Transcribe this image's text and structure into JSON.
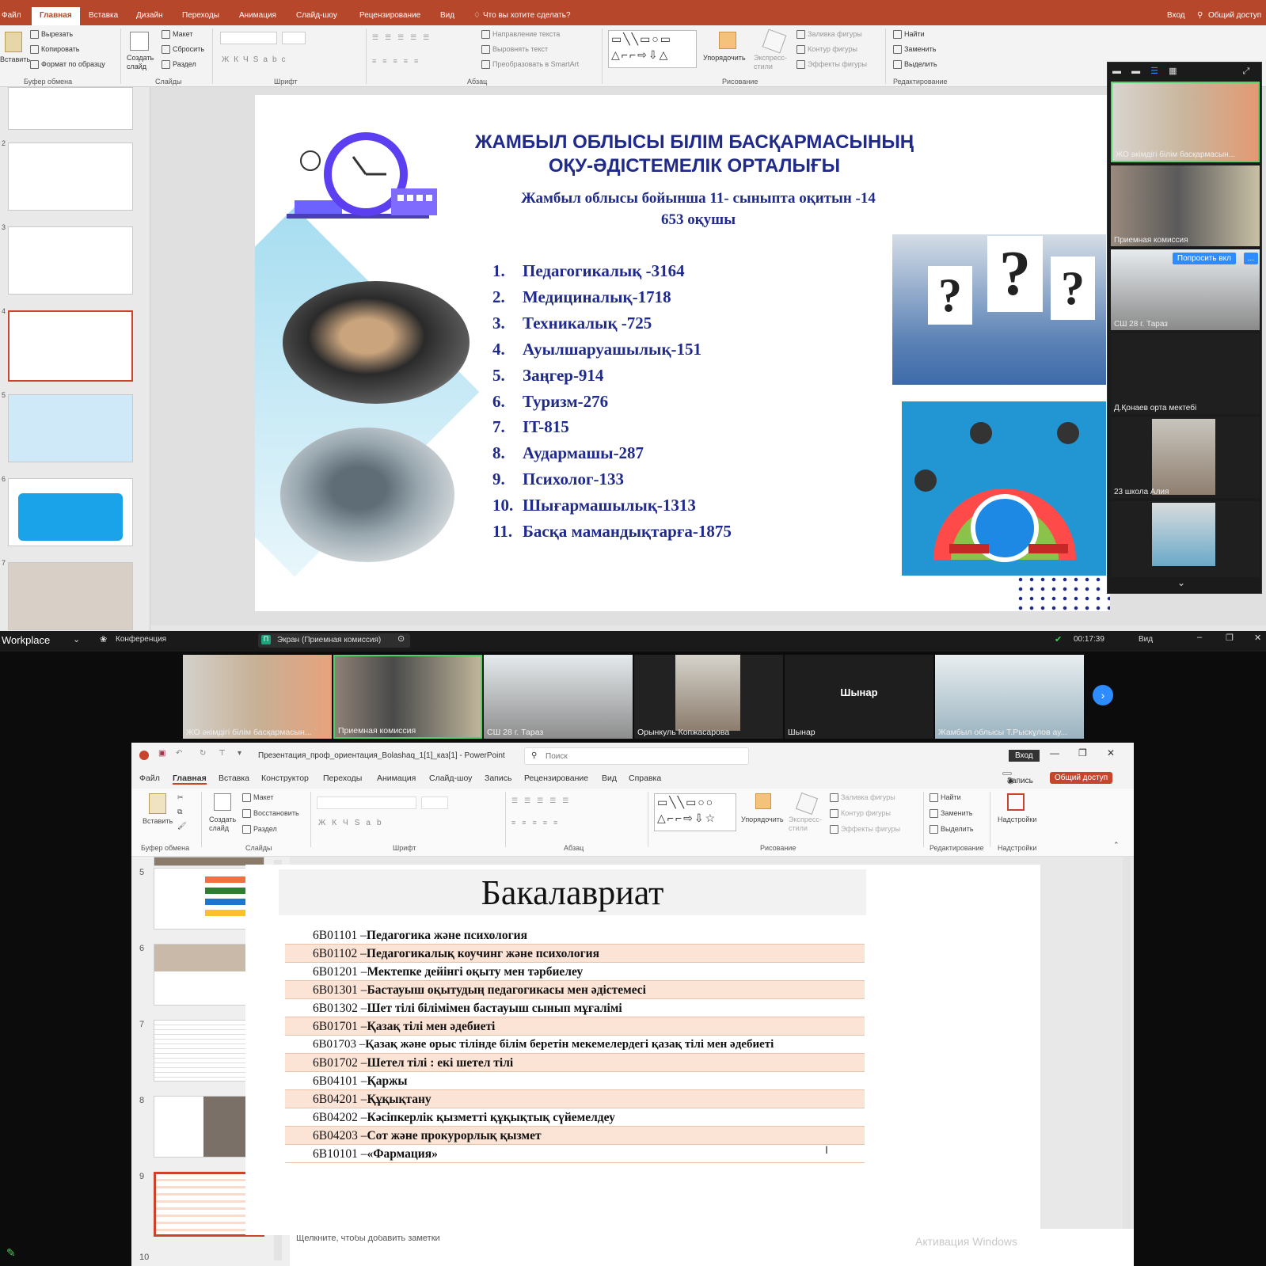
{
  "top_ppt": {
    "tabs": [
      "Файл",
      "Главная",
      "Вставка",
      "Дизайн",
      "Переходы",
      "Анимация",
      "Слайд-шоу",
      "Рецензирование",
      "Вид"
    ],
    "tell_me": "Что вы хотите сделать?",
    "signin": "Вход",
    "share": "Общий доступ",
    "ribbon": {
      "paste": "Вставить",
      "cut": "Вырезать",
      "copy": "Копировать",
      "format_painter": "Формат по образцу",
      "clipboard": "Буфер обмена",
      "new_slide": "Создать слайд",
      "layout": "Макет",
      "reset": "Сбросить",
      "section": "Раздел",
      "slides": "Слайды",
      "font": "Шрифт",
      "text_direction": "Направление текста",
      "align_text": "Выровнять текст",
      "smartart": "Преобразовать в SmartArt",
      "paragraph": "Абзац",
      "arrange": "Упорядочить",
      "quick_styles": "Экспресс-стили",
      "shape_fill": "Заливка фигуры",
      "shape_outline": "Контур фигуры",
      "shape_effects": "Эффекты фигуры",
      "drawing": "Рисование",
      "find": "Найти",
      "replace": "Заменить",
      "select": "Выделить",
      "editing": "Редактирование"
    },
    "slide": {
      "title_line1": "ЖАМБЫЛ ОБЛЫСЫ БІЛІМ БАСҚАРМАСЫНЫҢ",
      "title_line2": "ОҚУ-ӘДІСТЕМЕЛІК ОРТАЛЫҒЫ",
      "subtitle_line1": "Жамбыл облысы  бойынша 11- сыныпта  оқитын  -14",
      "subtitle_line2": "653 оқушы",
      "items": [
        {
          "n": "1.",
          "t": "Педагогикалық -3164"
        },
        {
          "n": "2.",
          "t": "Медициналық-1718"
        },
        {
          "n": "3.",
          "t": "Техникалық -725"
        },
        {
          "n": "4.",
          "t": "Ауылшаруашылық-151"
        },
        {
          "n": "5.",
          "t": "Заңгер-914"
        },
        {
          "n": "6.",
          "t": "Туризм-276"
        },
        {
          "n": "7.",
          "t": "IT-815"
        },
        {
          "n": "8.",
          "t": "Аудармашы-287"
        },
        {
          "n": "9.",
          "t": "Психолог-133"
        },
        {
          "n": "10.",
          "t": "Шығармашылық-1313"
        },
        {
          "n": "11.",
          "t": "Басқа мамандықтарға-1875"
        }
      ]
    },
    "thumb_numbers": [
      "2",
      "3",
      "4",
      "5",
      "6",
      "7"
    ],
    "gallery": {
      "participants": [
        "ЖО әкімдігі білім басқармасын...",
        "Приемная комиссия",
        "СШ 28 г. Тараз",
        "Д.Қонаев орта мектебі",
        "23 школа Алия"
      ],
      "ask_button": "Попросить вкл",
      "more": "..."
    }
  },
  "zoom": {
    "app": "Workplace",
    "conference": "Конференция",
    "screen_label": "Экран (Приемная комиссия)",
    "timer": "00:17:39",
    "view": "Вид",
    "participants": [
      {
        "name": "ЖО әкімдігі білім басқармасын..."
      },
      {
        "name": "Приемная комиссия"
      },
      {
        "name": "СШ 28 г. Тараз"
      },
      {
        "name": "Орынкуль Копжасарова"
      },
      {
        "name": "Шынар",
        "big": "Шынар"
      },
      {
        "name": "Жамбыл облысы Т.Рыскұлов ау..."
      }
    ]
  },
  "bot_ppt": {
    "filename": "Презентация_проф_ориентация_Bolashaq_1[1]_каз[1]  -  PowerPoint",
    "search_placeholder": "Поиск",
    "signin": "Вход",
    "tabs": [
      "Файл",
      "Главная",
      "Вставка",
      "Конструктор",
      "Переходы",
      "Анимация",
      "Слайд-шоу",
      "Запись",
      "Рецензирование",
      "Вид",
      "Справка"
    ],
    "record": "Запись",
    "share": "Общий доступ",
    "ribbon": {
      "paste": "Вставить",
      "new_slide": "Создать слайд",
      "layout": "Макет",
      "restore": "Восстановить",
      "section": "Раздел",
      "clipboard": "Буфер обмена",
      "slides": "Слайды",
      "font": "Шрифт",
      "paragraph": "Абзац",
      "arrange": "Упорядочить",
      "quick_styles": "Экспресс-стили",
      "shape_fill": "Заливка фигуры",
      "shape_outline": "Контур фигуры",
      "shape_effects": "Эффекты фигуры",
      "drawing": "Рисование",
      "find": "Найти",
      "replace": "Заменить",
      "select": "Выделить",
      "editing": "Редактирование",
      "addins": "Надстройки",
      "addins_group": "Надстройки"
    },
    "thumb_numbers": [
      "5",
      "6",
      "7",
      "8",
      "9",
      "10"
    ],
    "slide": {
      "title": "Бакалавриат",
      "rows": [
        {
          "code": "6В01101 – ",
          "name": "Педагогика және психология"
        },
        {
          "code": "6В01102 – ",
          "name": "Педагогикалық коучинг және  психология"
        },
        {
          "code": "6В01201 – ",
          "name": "Мектепке дейінгі оқыту мен тәрбиелеу"
        },
        {
          "code": "6В01301 – ",
          "name": "Бастауыш оқытудың педагогикасы мен әдістемесі"
        },
        {
          "code": "6В01302 – ",
          "name": "Шет тілі білімімен бастауыш сынып мұғалімі"
        },
        {
          "code": "6В01701 – ",
          "name": "Қазақ тілі мен әдебиеті"
        },
        {
          "code": "6В01703 – ",
          "name": "Қазақ және орыс тілінде білім беретін мекемелердегі қазақ тілі мен әдебиеті"
        },
        {
          "code": "6В01702 – ",
          "name": "Шетел тілі : екі шетел тілі"
        },
        {
          "code": "6В04101 – ",
          "name": "Қаржы"
        },
        {
          "code": "6В04201 – ",
          "name": "Құқықтану"
        },
        {
          "code": "6В04202 – ",
          "name": "Кәсіпкерлік қызметті құқықтық сүйемелдеу"
        },
        {
          "code": "6В04203 – ",
          "name": "Сот және прокурорлық қызмет"
        },
        {
          "code": "6В10101 – ",
          "name": "«Фармация»"
        }
      ]
    },
    "notes_placeholder": "Щелкните, чтобы добавить заметки",
    "activation": "Активация Windows"
  },
  "colors": {
    "ppt_red": "#b7472a",
    "slide_blue": "#1f2a8a",
    "row_alt": "#fbe3d6"
  }
}
